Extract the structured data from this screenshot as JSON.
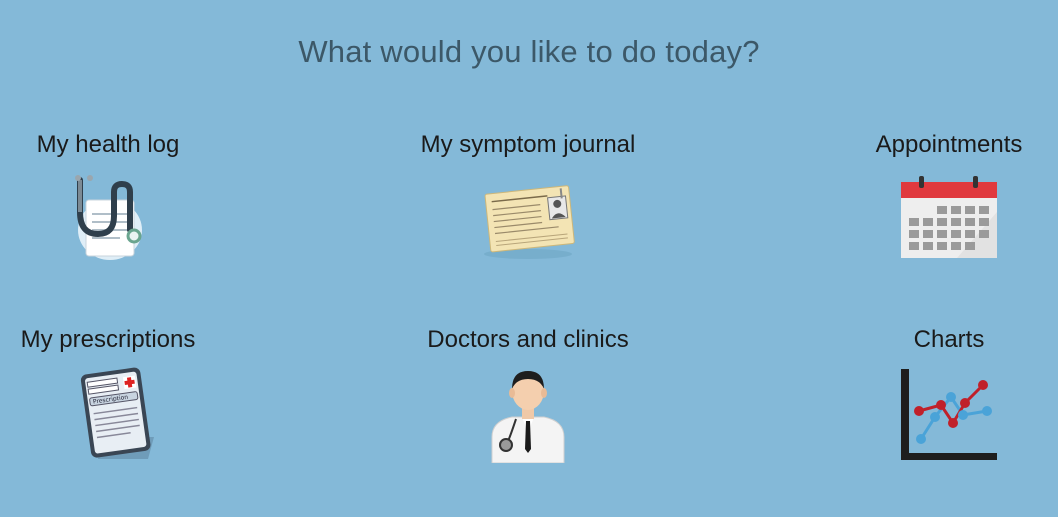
{
  "header": {
    "title": "What would you like to do today?"
  },
  "tiles": [
    {
      "label": "My health log",
      "icon": "stethoscope-document-icon"
    },
    {
      "label": "My symptom journal",
      "icon": "id-card-journal-icon"
    },
    {
      "label": "Appointments",
      "icon": "calendar-icon"
    },
    {
      "label": "My prescriptions",
      "icon": "prescription-clipboard-icon"
    },
    {
      "label": "Doctors and clinics",
      "icon": "doctor-icon"
    },
    {
      "label": "Charts",
      "icon": "line-chart-icon"
    }
  ],
  "colors": {
    "background": "#84b9d8",
    "heading": "#3c5868",
    "label": "#1a1a1a"
  }
}
